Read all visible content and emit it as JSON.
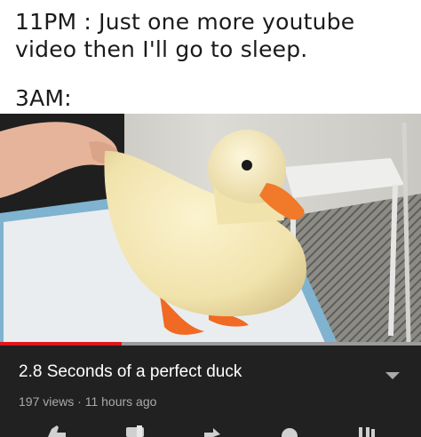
{
  "meme": {
    "line1": "11PM : Just one more youtube",
    "line2": "video then I'll go to sleep.",
    "line3": "3AM:"
  },
  "player": {
    "progress": 0.29,
    "progress_color": "#e0161b"
  },
  "video": {
    "title": "2.8 Seconds of a perfect duck",
    "meta": "197 views · 11 hours ago",
    "expand_icon": "chevron-down-icon"
  },
  "actions": [
    "like-icon",
    "dislike-icon",
    "share-icon",
    "download-icon",
    "save-icon"
  ],
  "colors": {
    "panel_bg": "#212121",
    "meta_text": "#aaaaaa"
  }
}
